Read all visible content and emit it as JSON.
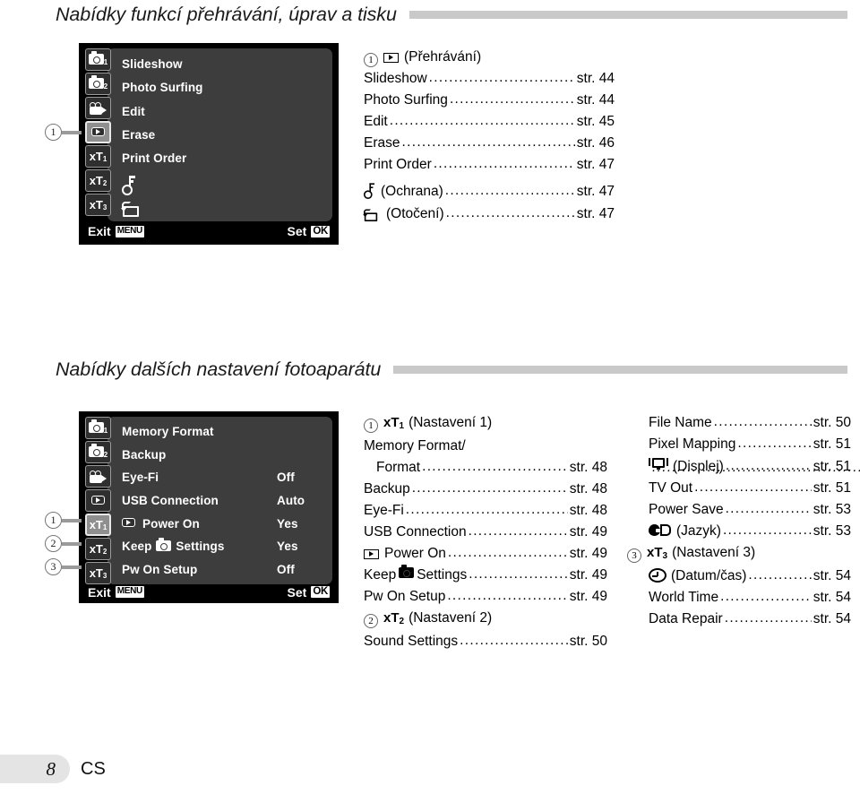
{
  "page": {
    "number": "8",
    "locale": "CS"
  },
  "sections": [
    {
      "heading": "Nabídky funkcí přehrávání, úprav a tisku",
      "lcd": {
        "tabs": [
          {
            "name": "camera1",
            "sub": "1",
            "selected": false
          },
          {
            "name": "camera2",
            "sub": "2",
            "selected": false
          },
          {
            "name": "movie",
            "sub": "",
            "selected": false
          },
          {
            "name": "playback",
            "sub": "",
            "selected": true
          },
          {
            "name": "wrench1",
            "sub": "1",
            "selected": false
          },
          {
            "name": "wrench2",
            "sub": "2",
            "selected": false
          },
          {
            "name": "wrench3",
            "sub": "3",
            "selected": false
          }
        ],
        "rows": [
          {
            "label": "Slideshow",
            "value": "",
            "icon": ""
          },
          {
            "label": "Photo Surfing",
            "value": "",
            "icon": ""
          },
          {
            "label": "Edit",
            "value": "",
            "icon": ""
          },
          {
            "label": "Erase",
            "value": "",
            "icon": ""
          },
          {
            "label": "Print Order",
            "value": "",
            "icon": ""
          },
          {
            "label": "",
            "value": "",
            "icon": "key-icon"
          },
          {
            "label": "",
            "value": "",
            "icon": "rotate-icon"
          }
        ],
        "exit_label": "Exit",
        "exit_key": "MENU",
        "set_label": "Set",
        "set_key": "OK"
      },
      "callouts": [
        {
          "num": "1"
        }
      ],
      "ref_columns": [
        {
          "lines": [
            {
              "marker": "1",
              "icon": "playback-icon",
              "name": "(Přehrávání)",
              "dots": false,
              "page": ""
            },
            {
              "marker": "",
              "icon": "",
              "name": "Slideshow",
              "dots": true,
              "page": "str. 44"
            },
            {
              "marker": "",
              "icon": "",
              "name": "Photo Surfing",
              "dots": true,
              "page": "str. 44"
            },
            {
              "marker": "",
              "icon": "",
              "name": "Edit",
              "dots": true,
              "page": "str. 45"
            },
            {
              "marker": "",
              "icon": "",
              "name": "Erase",
              "dots": true,
              "page": "str. 46"
            },
            {
              "marker": "",
              "icon": "",
              "name": "Print Order",
              "dots": true,
              "page": "str. 47"
            },
            {
              "marker": "",
              "icon": "key-icon",
              "name": "(Ochrana)",
              "dots": true,
              "page": "str. 47"
            },
            {
              "marker": "",
              "icon": "rotate-icon",
              "name": "(Otočení)",
              "dots": true,
              "page": "str. 47"
            }
          ]
        }
      ]
    },
    {
      "heading": "Nabídky dalších nastavení fotoaparátu",
      "lcd": {
        "tabs": [
          {
            "name": "camera1",
            "sub": "1",
            "selected": false
          },
          {
            "name": "camera2",
            "sub": "2",
            "selected": false
          },
          {
            "name": "movie",
            "sub": "",
            "selected": false
          },
          {
            "name": "playback",
            "sub": "",
            "selected": false
          },
          {
            "name": "wrench1",
            "sub": "1",
            "selected": true
          },
          {
            "name": "wrench2",
            "sub": "2",
            "selected": false
          },
          {
            "name": "wrench3",
            "sub": "3",
            "selected": false
          }
        ],
        "rows": [
          {
            "label": "Memory Format",
            "value": "",
            "icon": ""
          },
          {
            "label": "Backup",
            "value": "",
            "icon": ""
          },
          {
            "label": "Eye-Fi",
            "value": "Off",
            "icon": ""
          },
          {
            "label": "USB Connection",
            "value": "Auto",
            "icon": ""
          },
          {
            "label": "Power On",
            "value": "Yes",
            "icon": "playback-icon"
          },
          {
            "label": "Settings",
            "value": "Yes",
            "icon": "keep-camera-icon",
            "prefix": "Keep"
          },
          {
            "label": "Pw On Setup",
            "value": "Off",
            "icon": ""
          }
        ],
        "exit_label": "Exit",
        "exit_key": "MENU",
        "set_label": "Set",
        "set_key": "OK"
      },
      "callouts": [
        {
          "num": "1"
        },
        {
          "num": "2"
        },
        {
          "num": "3"
        }
      ],
      "ref_columns": [
        {
          "lines": [
            {
              "marker": "1",
              "icon": "wrench1-icon",
              "name": "(Nastavení 1)",
              "dots": false,
              "page": ""
            },
            {
              "marker": "",
              "icon": "",
              "name": "Memory Format/",
              "dots": false,
              "page": ""
            },
            {
              "marker": "",
              "icon": "",
              "name": "Format",
              "dots": true,
              "page": "str. 48",
              "indent": true
            },
            {
              "marker": "",
              "icon": "",
              "name": "Backup",
              "dots": true,
              "page": "str. 48"
            },
            {
              "marker": "",
              "icon": "",
              "name": "Eye-Fi",
              "dots": true,
              "page": "str. 48"
            },
            {
              "marker": "",
              "icon": "",
              "name": "USB Connection",
              "dots": true,
              "page": "str. 49"
            },
            {
              "marker": "",
              "icon": "playback-icon",
              "name": "Power On",
              "dots": true,
              "page": "str. 49"
            },
            {
              "marker": "",
              "icon": "keep-camera-icon",
              "name": "Settings",
              "dots": true,
              "page": "str. 49",
              "prefix": "Keep"
            },
            {
              "marker": "",
              "icon": "",
              "name": "Pw On Setup",
              "dots": true,
              "page": "str. 49"
            },
            {
              "marker": "2",
              "icon": "wrench2-icon",
              "name": "(Nastavení 2)",
              "dots": false,
              "page": ""
            },
            {
              "marker": "",
              "icon": "",
              "name": "Sound Settings",
              "dots": true,
              "page": "str. 50"
            }
          ]
        },
        {
          "lines": [
            {
              "marker": "",
              "icon": "",
              "name": "File Name",
              "dots": true,
              "page": "str. 50"
            },
            {
              "marker": "",
              "icon": "",
              "name": "Pixel Mapping",
              "dots": true,
              "page": "str. 51"
            },
            {
              "marker": "",
              "icon": "display-icon",
              "name": "(Displej)",
              "dots": true,
              "page": "str. 51"
            },
            {
              "marker": "",
              "icon": "",
              "name": "TV Out",
              "dots": true,
              "page": "str. 51"
            },
            {
              "marker": "",
              "icon": "",
              "name": "Power Save",
              "dots": true,
              "page": "str. 53"
            },
            {
              "marker": "",
              "icon": "language-icon",
              "name": "(Jazyk)",
              "dots": true,
              "page": "str. 53"
            },
            {
              "marker": "3",
              "icon": "wrench3-icon",
              "name": "(Nastavení 3)",
              "dots": false,
              "page": ""
            },
            {
              "marker": "",
              "icon": "clock-icon",
              "name": "(Datum/čas)",
              "dots": true,
              "page": "str. 54"
            },
            {
              "marker": "",
              "icon": "",
              "name": "World Time",
              "dots": true,
              "page": "str. 54"
            },
            {
              "marker": "",
              "icon": "",
              "name": "Data Repair",
              "dots": true,
              "page": "str. 54"
            }
          ]
        }
      ]
    }
  ],
  "colors": {
    "rule": "#c9c9c9",
    "lcd_bg": "#000000",
    "pane_bg": "#3d3d3d",
    "tab_sel": "#8f8f8f"
  }
}
